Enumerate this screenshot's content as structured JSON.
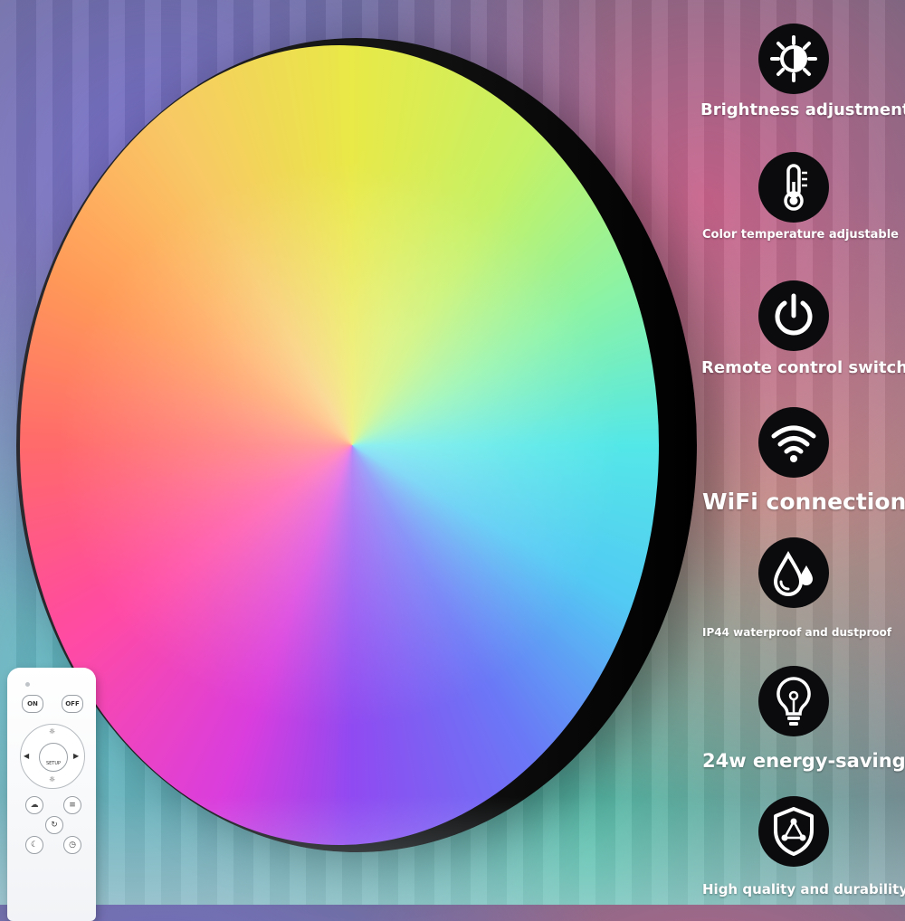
{
  "features": [
    {
      "label": "Brightness adjustment",
      "icon": "brightness-icon"
    },
    {
      "label": "Color temperature adjustable",
      "icon": "thermometer-icon"
    },
    {
      "label": "Remote control switch",
      "icon": "power-icon"
    },
    {
      "label": "WiFi connection",
      "icon": "wifi-icon"
    },
    {
      "label": "IP44 waterproof and dustproof",
      "icon": "water-drop-icon"
    },
    {
      "label": "24w energy-saving",
      "icon": "light-bulb-icon"
    },
    {
      "label": "High quality and durability",
      "icon": "shield-icon"
    }
  ],
  "remote": {
    "on_label": "ON",
    "off_label": "OFF",
    "setup_label": "SETUP"
  },
  "colors": {
    "icon_background": "#0b0b0d",
    "label_text": "#ffffff",
    "lamp_rim": "#111111"
  }
}
